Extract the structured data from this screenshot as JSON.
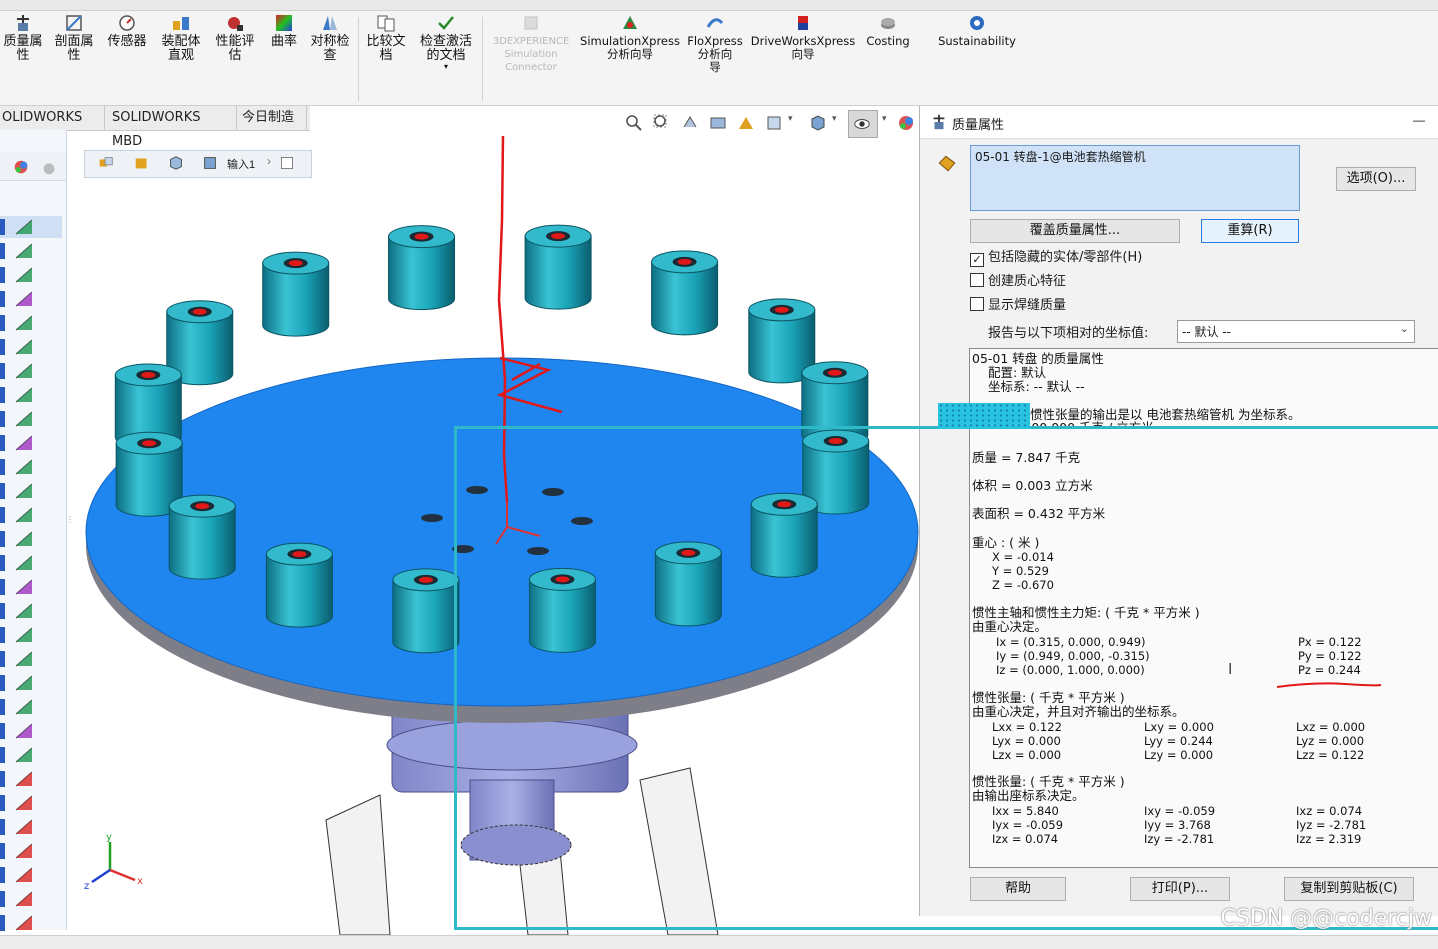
{
  "ribbon": {
    "items": [
      {
        "label": "质量属\n性",
        "icon": "mass-properties-icon"
      },
      {
        "label": "剖面属\n性",
        "icon": "section-properties-icon"
      },
      {
        "label": "传感器",
        "icon": "sensor-icon"
      },
      {
        "label": "装配体\n直观",
        "icon": "assembly-visualization-icon"
      },
      {
        "label": "性能评\n估",
        "icon": "performance-evaluation-icon"
      },
      {
        "label": "曲率",
        "icon": "curvature-icon"
      },
      {
        "label": "对称检\n查",
        "icon": "symmetry-check-icon"
      },
      {
        "label": "比较文\n档",
        "icon": "compare-documents-icon"
      },
      {
        "label": "检查激活\n的文档",
        "icon": "check-active-document-icon"
      },
      {
        "label": "3DEXPERIENCE\nSimulation\nConnector",
        "icon": "3dexperience-icon"
      },
      {
        "label": "SimulationXpress\n分析向导",
        "icon": "simulationxpress-icon"
      },
      {
        "label": "FloXpress\n分析向\n导",
        "icon": "floxpress-icon"
      },
      {
        "label": "DriveWorksXpress\n向导",
        "icon": "driveworksxpress-icon"
      },
      {
        "label": "Costing",
        "icon": "costing-icon"
      },
      {
        "label": "Sustainability",
        "icon": "sustainability-icon"
      }
    ]
  },
  "tabs": [
    "OLIDWORKS 插件",
    "SOLIDWORKS MBD",
    "今日制造"
  ],
  "breadcrumb": {
    "item": "输入1"
  },
  "dialog": {
    "title": "质量属性",
    "minimize": "—",
    "selection": "05-01 转盘-1@电池套热缩管机",
    "options_button": "选项(O)...",
    "override_button": "覆盖质量属性...",
    "recalc_button": "重算(R)",
    "checkboxes": [
      {
        "label": "包括隐藏的实体/零部件(H)",
        "checked": "✓"
      },
      {
        "label": "创建质心特征",
        "checked": ""
      },
      {
        "label": "显示焊缝质量",
        "checked": ""
      }
    ],
    "coord_label": "报告与以下项相对的坐标值:",
    "coord_value": "-- 默认 --",
    "results": {
      "header": "05-01 转盘 的质量属性",
      "config": "配置:  默认",
      "coordsys": "坐标系:  -- 默认 --",
      "note": "惯性张量的输出是以 电池套热缩管机 为坐标系。",
      "density_partial": "密度 = 2700.000 千克 / 立方米",
      "mass": "质量 = 7.847 千克",
      "volume": "体积 = 0.003 立方米",
      "surface": "表面积 = 0.432 平方米",
      "cog_title": "重心 : ( 米 )",
      "cog": [
        "X = -0.014",
        "Y = 0.529",
        "Z = -0.670"
      ],
      "principal_title": "惯性主轴和惯性主力矩: ( 千克 * 平方米 )",
      "principal_sub": "由重心决定。",
      "principal_axes": [
        "Ix = (0.315,  0.000,  0.949)",
        "Iy = (0.949,  0.000, -0.315)",
        "Iz = (0.000,  1.000,  0.000)"
      ],
      "principal_moments": [
        "Px = 0.122",
        "Py = 0.122",
        "Pz = 0.244"
      ],
      "tensor1_title": "惯性张量: ( 千克 * 平方米 )",
      "tensor1_sub": "由重心决定，并且对齐输出的坐标系。",
      "tensor1": [
        [
          "Lxx = 0.122",
          "Lxy = 0.000",
          "Lxz = 0.000"
        ],
        [
          "Lyx = 0.000",
          "Lyy = 0.244",
          "Lyz = 0.000"
        ],
        [
          "Lzx = 0.000",
          "Lzy = 0.000",
          "Lzz = 0.122"
        ]
      ],
      "tensor2_title": "惯性张量: ( 千克 * 平方米 )",
      "tensor2_sub": "由输出座标系决定。",
      "tensor2": [
        [
          "Ixx = 5.840",
          "Ixy = -0.059",
          "Ixz = 0.074"
        ],
        [
          "Iyx = -0.059",
          "Iyy = 3.768",
          "Iyz = -2.781"
        ],
        [
          "Izx = 0.074",
          "Izy = -2.781",
          "Izz = 2.319"
        ]
      ]
    },
    "help_button": "帮助",
    "print_button": "打印(P)...",
    "copy_button": "复制到剪贴板(C)"
  },
  "axes_labels": {
    "x": "x",
    "y": "y",
    "z": "z"
  },
  "watermark": "CSDN @@codercjw",
  "colors": {
    "plate": "#1f86f0",
    "cylinder": "#1fa7b8",
    "annotation": "#e01818",
    "overlay": "#2fb8c6"
  }
}
